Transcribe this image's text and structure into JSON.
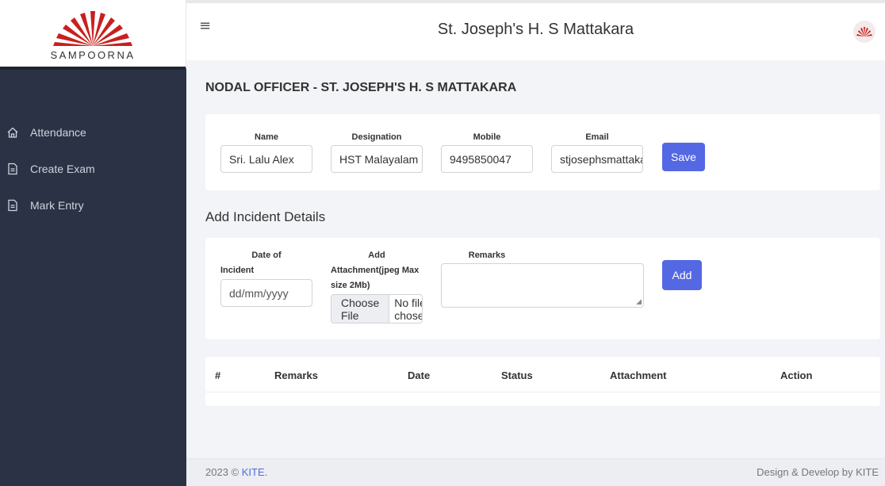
{
  "brand": {
    "name": "SAMPOORNA"
  },
  "sidebar": {
    "items": [
      {
        "label": "Attendance",
        "icon": "home-icon"
      },
      {
        "label": "Create Exam",
        "icon": "document-icon"
      },
      {
        "label": "Mark Entry",
        "icon": "document-icon"
      }
    ]
  },
  "header": {
    "title": "St. Joseph's H. S Mattakara",
    "menu_icon": "≡"
  },
  "nodal": {
    "heading": "NODAL OFFICER - ST. JOSEPH'S H. S MATTAKARA",
    "name_label": "Name",
    "name_value": "Sri. Lalu Alex",
    "designation_label": "Designation",
    "designation_value": "HST Malayalam",
    "mobile_label": "Mobile",
    "mobile_value": "9495850047",
    "email_label": "Email",
    "email_value": "stjosephsmattakara",
    "save_label": "Save"
  },
  "incident": {
    "title": "Add Incident Details",
    "date_label_1": "Date of",
    "date_label_2": "Incident",
    "date_placeholder": "dd/mm/yyyy",
    "attachment_label_1": "Add",
    "attachment_label_2": "Attachment(jpeg Max",
    "attachment_label_3": "size 2Mb)",
    "choose_file_label": "Choose File",
    "no_file_text": "No file chosen",
    "remarks_label": "Remarks",
    "add_label": "Add"
  },
  "table": {
    "columns": [
      "#",
      "Remarks",
      "Date",
      "Status",
      "Attachment",
      "Action"
    ]
  },
  "footer": {
    "copyright_prefix": "2023 © ",
    "copyright_link": "KITE.",
    "credit": "Design & Develop by KITE"
  },
  "colors": {
    "sidebar_bg": "#2b3245",
    "accent": "#5468e4",
    "logo_red": "#c8201f"
  }
}
